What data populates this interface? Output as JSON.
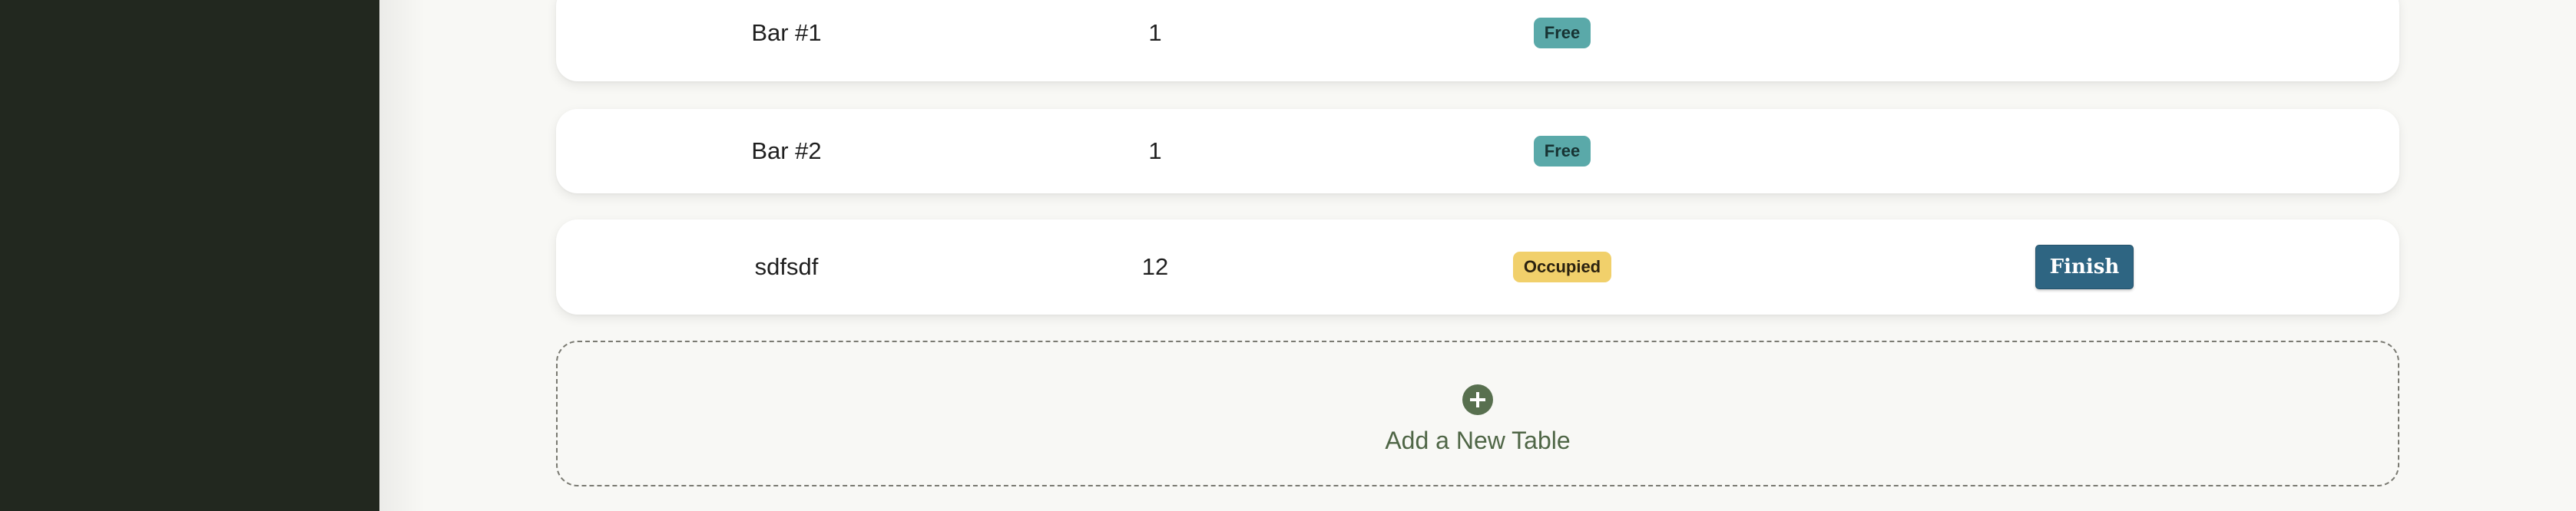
{
  "tables": [
    {
      "name": "Bar #1",
      "seats": "1",
      "status": "Free",
      "status_type": "free",
      "action": ""
    },
    {
      "name": "Bar #2",
      "seats": "1",
      "status": "Free",
      "status_type": "free",
      "action": ""
    },
    {
      "name": "sdfsdf",
      "seats": "12",
      "status": "Occupied",
      "status_type": "occupied",
      "action": "Finish"
    }
  ],
  "add_table": {
    "label": "Add a New Table",
    "icon": "plus-circle-icon"
  },
  "colors": {
    "sidebar": "#22281f",
    "background": "#f8f8f5",
    "free_badge": "#5aa9a9",
    "occupied_badge": "#f1d06b",
    "finish_button": "#2e6582",
    "accent_green": "#58704f"
  }
}
